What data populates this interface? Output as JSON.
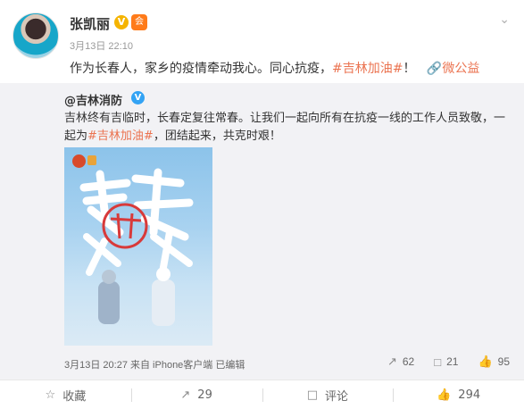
{
  "post": {
    "author": "张凯丽",
    "v_badge": "V",
    "member_badge": "会",
    "time": "3月13日 22:10",
    "text_before": "作为长春人，家乡的疫情牵动我心。同心抗疫，",
    "hashtag": "#吉林加油#",
    "text_after": "！",
    "link_icon": "🔗",
    "link_label": "微公益"
  },
  "repost": {
    "author": "@吉林消防",
    "v_badge": "V",
    "text_line1": "吉林终有吉临时，长春定复往常春。让我们一起向所有在抗疫一线的工作人员致敬，一起为",
    "hashtag": "#吉林加油#",
    "text_line2": "，团结起来，共克时艰！",
    "meta": "3月13日 20:27 来自 iPhone客户端  已编辑",
    "actions": {
      "repost_count": "62",
      "comment_count": "21",
      "like_count": "95"
    }
  },
  "bottom_bar": {
    "favorite_label": "收藏",
    "repost_count": "29",
    "comment_label": "评论",
    "like_count": "294"
  },
  "colors": {
    "hashtag": "#eb7350",
    "verified_gold": "#f5b400",
    "verified_blue": "#33a3f4"
  }
}
